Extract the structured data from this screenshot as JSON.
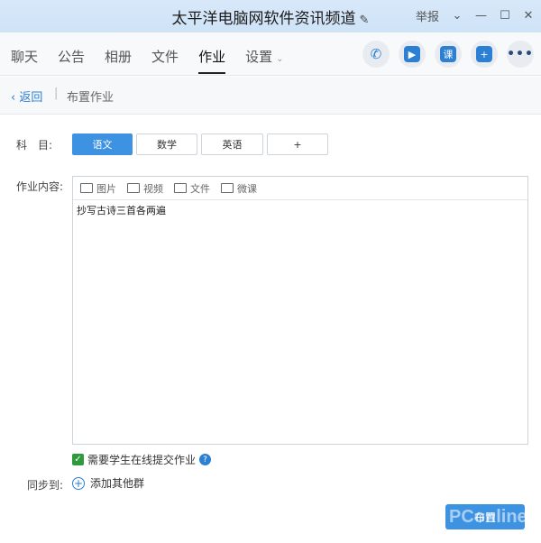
{
  "window": {
    "title": "太平洋电脑网软件资讯频道",
    "report": "举报"
  },
  "tabs": [
    {
      "label": "聊天"
    },
    {
      "label": "公告"
    },
    {
      "label": "相册"
    },
    {
      "label": "文件"
    },
    {
      "label": "作业"
    },
    {
      "label": "设置"
    }
  ],
  "actions": {
    "course": "课"
  },
  "nav": {
    "back": "返回",
    "breadcrumb": "布置作业"
  },
  "form": {
    "subject_label": "科　目:",
    "subjects": [
      "语文",
      "数学",
      "英语",
      "+"
    ],
    "content_label": "作业内容:",
    "toolbar": [
      "图片",
      "视频",
      "文件",
      "微课"
    ],
    "content_text": "抄写古诗三首各两遍",
    "require_online": "需要学生在线提交作业",
    "sync_label": "同步到:",
    "add_group": "添加其他群",
    "submit": "布置"
  },
  "watermark": "PConline",
  "colors": {
    "accent": "#3d92e2",
    "check": "#2e9a3b"
  }
}
